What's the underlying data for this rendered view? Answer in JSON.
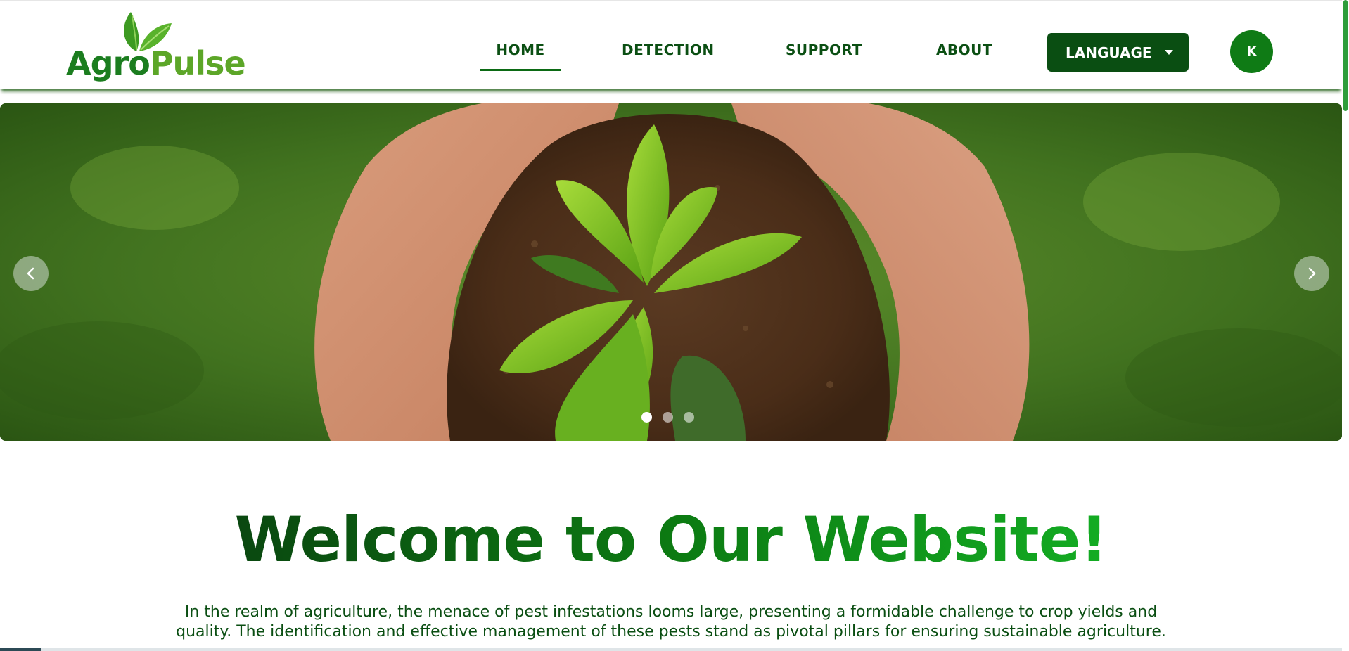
{
  "brand": {
    "name_part1": "Agro",
    "name_part2": "Pulse",
    "primary_color": "#0b4f13",
    "accent_color": "#5ca628"
  },
  "nav": {
    "items": [
      {
        "label": "HOME",
        "active": true
      },
      {
        "label": "DETECTION",
        "active": false
      },
      {
        "label": "SUPPORT",
        "active": false
      },
      {
        "label": "ABOUT",
        "active": false
      }
    ],
    "language_label": "LANGUAGE",
    "avatar_initial": "K"
  },
  "carousel": {
    "slide_count": 3,
    "active_slide": 1,
    "prev_icon": "chevron-left-icon",
    "next_icon": "chevron-right-icon"
  },
  "welcome": {
    "heading": "Welcome to Our Website!",
    "intro": "In the realm of agriculture, the menace of pest infestations looms large, presenting a formidable challenge to crop yields and quality. The identification and effective management of these pests stand as pivotal pillars for ensuring sustainable agriculture."
  }
}
